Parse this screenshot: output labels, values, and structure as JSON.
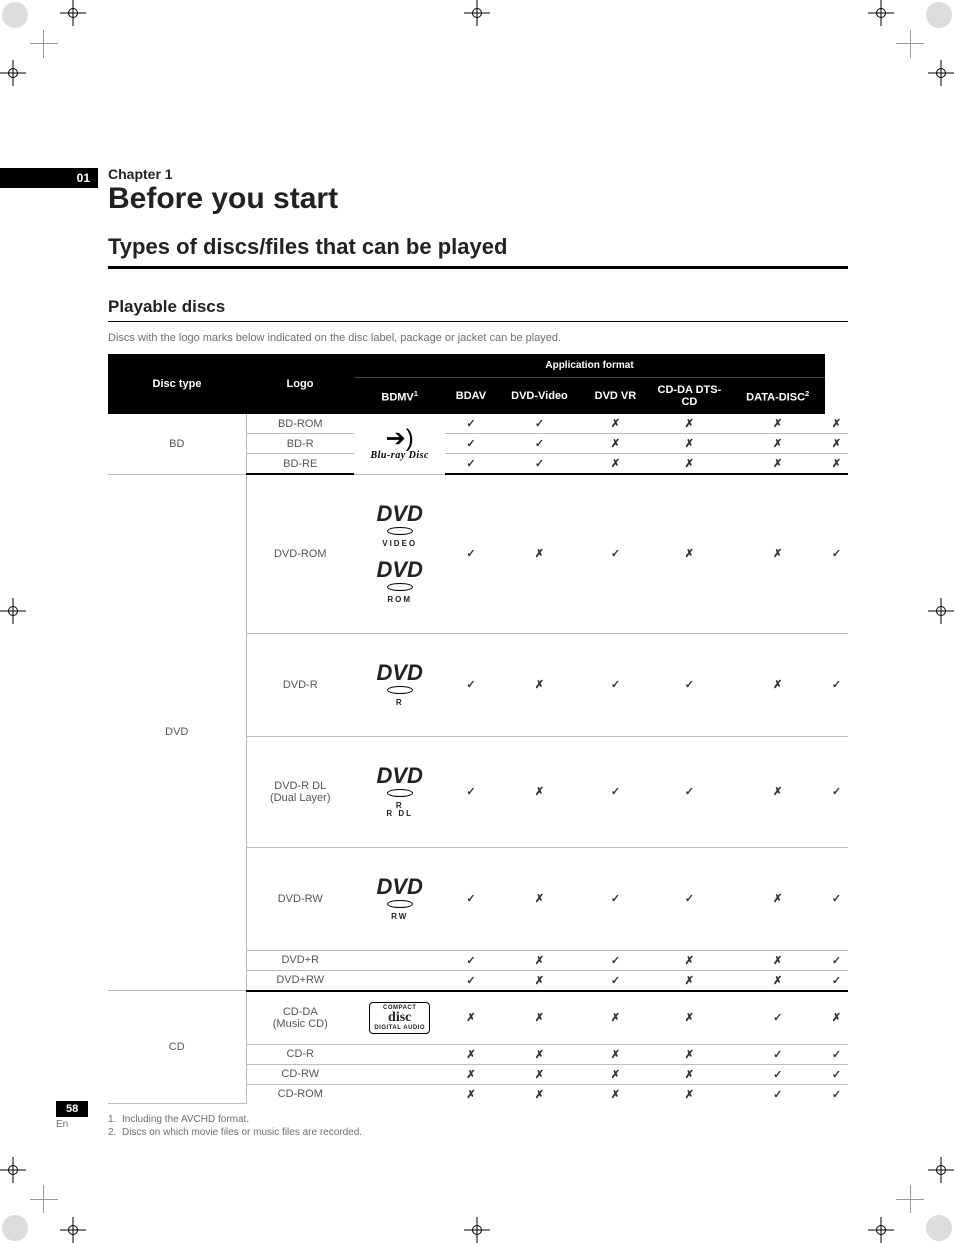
{
  "chapter_tab": "01",
  "chapter_label": "Chapter 1",
  "title": "Before you start",
  "section": "Types of discs/files that can be played",
  "subsection": "Playable discs",
  "intro": "Discs with the logo marks below indicated on the disc label, package or jacket can be played.",
  "header": {
    "disc_type": "Disc type",
    "logo": "Logo",
    "app_format": "Application format",
    "cols": [
      "BDMV",
      "BDAV",
      "DVD-Video",
      "DVD VR",
      "CD-DA DTS-CD",
      "DATA-DISC"
    ],
    "col1_sup": "1",
    "col6_sup": "2"
  },
  "symbols": {
    "yes": "✓",
    "no": "✗"
  },
  "groups": [
    {
      "category": "BD",
      "logo": "bluray",
      "rows": [
        {
          "disc": "BD-ROM",
          "v": [
            "yes",
            "yes",
            "no",
            "no",
            "no",
            "no"
          ]
        },
        {
          "disc": "BD-R",
          "v": [
            "yes",
            "yes",
            "no",
            "no",
            "no",
            "no"
          ]
        },
        {
          "disc": "BD-RE",
          "v": [
            "yes",
            "yes",
            "no",
            "no",
            "no",
            "no"
          ]
        }
      ]
    },
    {
      "category": "DVD",
      "rows": [
        {
          "disc": "DVD-ROM",
          "logo": "dvd-video-rom",
          "v": [
            "yes",
            "no",
            "yes",
            "no",
            "no",
            "yes"
          ],
          "tall": true
        },
        {
          "disc": "DVD-R",
          "logo": "dvd-r",
          "v": [
            "yes",
            "no",
            "yes",
            "yes",
            "no",
            "yes"
          ],
          "tall": true
        },
        {
          "disc": "DVD-R DL (Dual Layer)",
          "logo": "dvd-rdl",
          "v": [
            "yes",
            "no",
            "yes",
            "yes",
            "no",
            "yes"
          ],
          "tall": true
        },
        {
          "disc": "DVD-RW",
          "logo": "dvd-rw",
          "v": [
            "yes",
            "no",
            "yes",
            "yes",
            "no",
            "yes"
          ],
          "tall": true
        },
        {
          "disc": "DVD+R",
          "logo": "",
          "v": [
            "yes",
            "no",
            "yes",
            "no",
            "no",
            "yes"
          ]
        },
        {
          "disc": "DVD+RW",
          "logo": "",
          "v": [
            "yes",
            "no",
            "yes",
            "no",
            "no",
            "yes"
          ]
        }
      ]
    },
    {
      "category": "CD",
      "rows": [
        {
          "disc": "CD-DA (Music CD)",
          "logo": "cd",
          "v": [
            "no",
            "no",
            "no",
            "no",
            "yes",
            "no"
          ],
          "low": true
        },
        {
          "disc": "CD-R",
          "logo": "",
          "v": [
            "no",
            "no",
            "no",
            "no",
            "yes",
            "yes"
          ]
        },
        {
          "disc": "CD-RW",
          "logo": "",
          "v": [
            "no",
            "no",
            "no",
            "no",
            "yes",
            "yes"
          ]
        },
        {
          "disc": "CD-ROM",
          "logo": "",
          "v": [
            "no",
            "no",
            "no",
            "no",
            "yes",
            "yes"
          ]
        }
      ]
    }
  ],
  "footnotes": [
    {
      "n": "1.",
      "t": "Including the AVCHD format."
    },
    {
      "n": "2.",
      "t": "Discs on which movie files or music files are recorded."
    }
  ],
  "page_number": "58",
  "lang": "En",
  "logos": {
    "bluray_text": "Blu-ray Disc",
    "dvd": "DVD",
    "dvd_video": "VIDEO",
    "dvd_rom": "ROM",
    "dvd_r": "R",
    "dvd_rdl": "R DL",
    "dvd_rw": "RW",
    "cd_top": "COMPACT",
    "cd_mid": "disc",
    "cd_bot": "DIGITAL AUDIO"
  }
}
